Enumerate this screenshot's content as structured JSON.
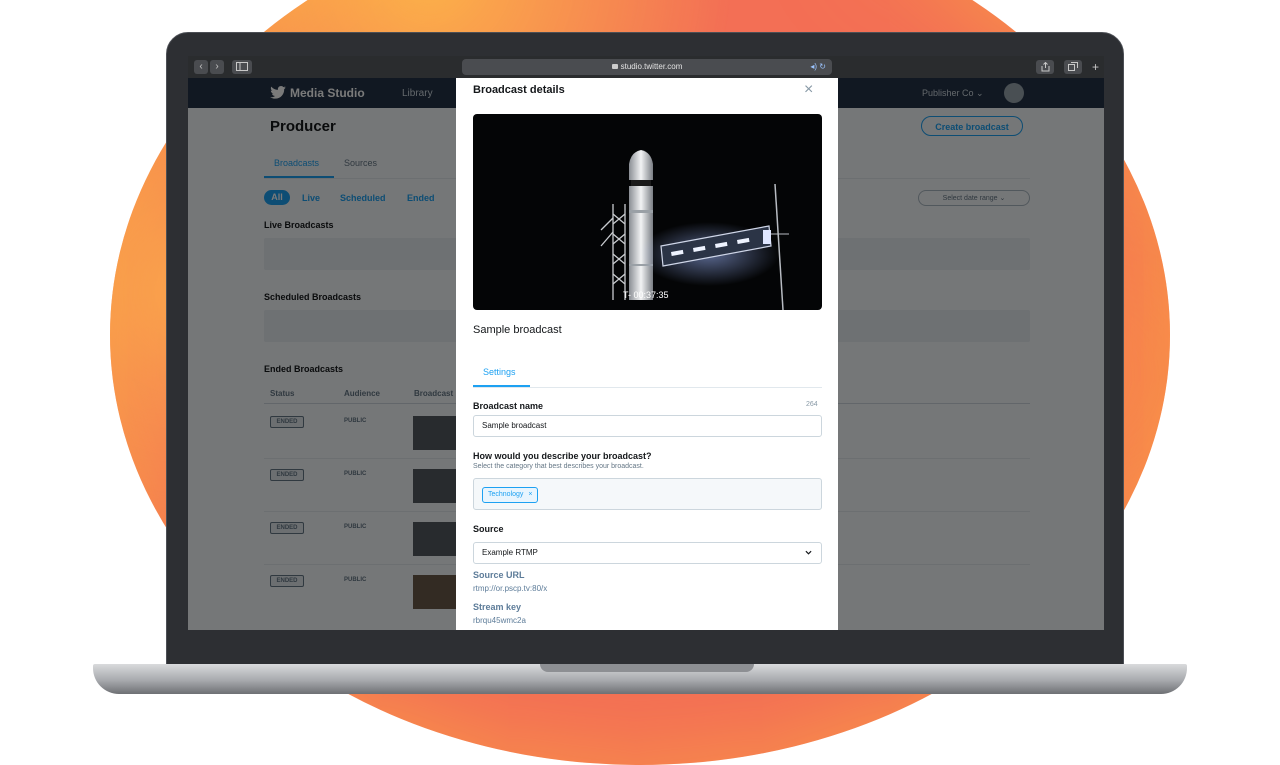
{
  "browser": {
    "url": "studio.twitter.com",
    "nav_back": "‹",
    "nav_forward": "›"
  },
  "app": {
    "brand": "Media Studio",
    "nav_library": "Library",
    "account": "Publisher Co ⌄"
  },
  "page": {
    "title": "Producer",
    "create_button": "Create broadcast",
    "tabs": [
      "Broadcasts",
      "Sources"
    ],
    "filters": [
      "All",
      "Live",
      "Scheduled",
      "Ended"
    ],
    "date_range": "Select date range ⌄",
    "sections": {
      "live": "Live Broadcasts",
      "scheduled": "Scheduled Broadcasts",
      "ended": "Ended Broadcasts"
    },
    "columns": [
      "Status",
      "Audience",
      "Broadcast"
    ],
    "rows": [
      {
        "status": "ENDED",
        "audience": "PUBLIC"
      },
      {
        "status": "ENDED",
        "audience": "PUBLIC"
      },
      {
        "status": "ENDED",
        "audience": "PUBLIC"
      },
      {
        "status": "ENDED",
        "audience": "PUBLIC"
      }
    ]
  },
  "modal": {
    "title": "Broadcast details",
    "close": "×",
    "video_timer": "T- 00:37:35",
    "broadcast_title": "Sample broadcast",
    "tab": "Settings",
    "name_label": "Broadcast name",
    "name_count": "264",
    "name_value": "Sample broadcast",
    "category_label": "How would you describe your broadcast?",
    "category_helper": "Select the category that best describes your broadcast.",
    "category_tag": "Technology",
    "category_tag_remove": "×",
    "source_label": "Source",
    "source_value": "Example RTMP",
    "source_url_label": "Source URL",
    "source_url": "rtmp://or.pscp.tv:80/x",
    "stream_key_label": "Stream key",
    "stream_key": "rbrqu45wmc2a"
  },
  "colors": {
    "accent": "#1da1f2",
    "header": "#243447",
    "backdrop": "#f36f55"
  }
}
